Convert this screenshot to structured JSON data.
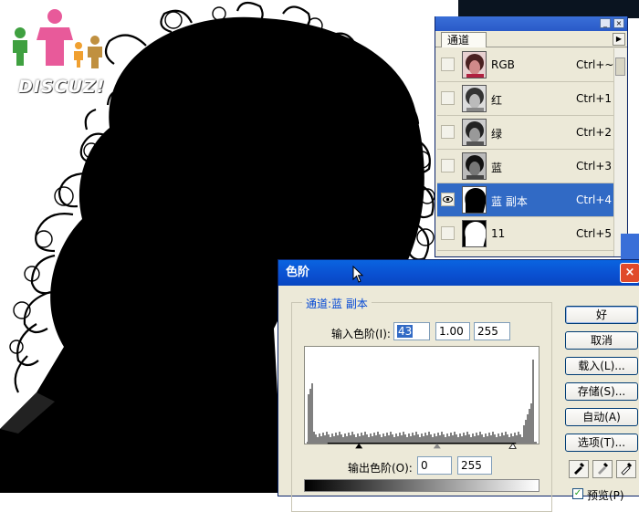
{
  "logo": {
    "text": "DISCUZ!"
  },
  "channels_panel": {
    "tab": "通道",
    "rows": [
      {
        "name": "RGB",
        "shortcut": "Ctrl+~",
        "selected": false
      },
      {
        "name": "红",
        "shortcut": "Ctrl+1",
        "selected": false
      },
      {
        "name": "绿",
        "shortcut": "Ctrl+2",
        "selected": false
      },
      {
        "name": "蓝",
        "shortcut": "Ctrl+3",
        "selected": false
      },
      {
        "name": "蓝 副本",
        "shortcut": "Ctrl+4",
        "selected": true
      },
      {
        "name": "11",
        "shortcut": "Ctrl+5",
        "selected": false
      }
    ]
  },
  "levels_dialog": {
    "title": "色阶",
    "channel_label": "通道:蓝 副本",
    "input_label": "输入色阶(I):",
    "input_black": "43",
    "input_gamma": "1.00",
    "input_white": "255",
    "output_label": "输出色阶(O):",
    "output_black": "0",
    "output_white": "255",
    "buttons": {
      "ok": "好",
      "cancel": "取消",
      "load": "载入(L)...",
      "save": "存储(S)...",
      "auto": "自动(A)",
      "options": "选项(T)..."
    },
    "preview_label": "预览(P)",
    "preview_checked": true
  },
  "colors": {
    "selection": "#316ac5",
    "titlebar": "#0a55d8",
    "dialog_bg": "#ece9d8"
  }
}
